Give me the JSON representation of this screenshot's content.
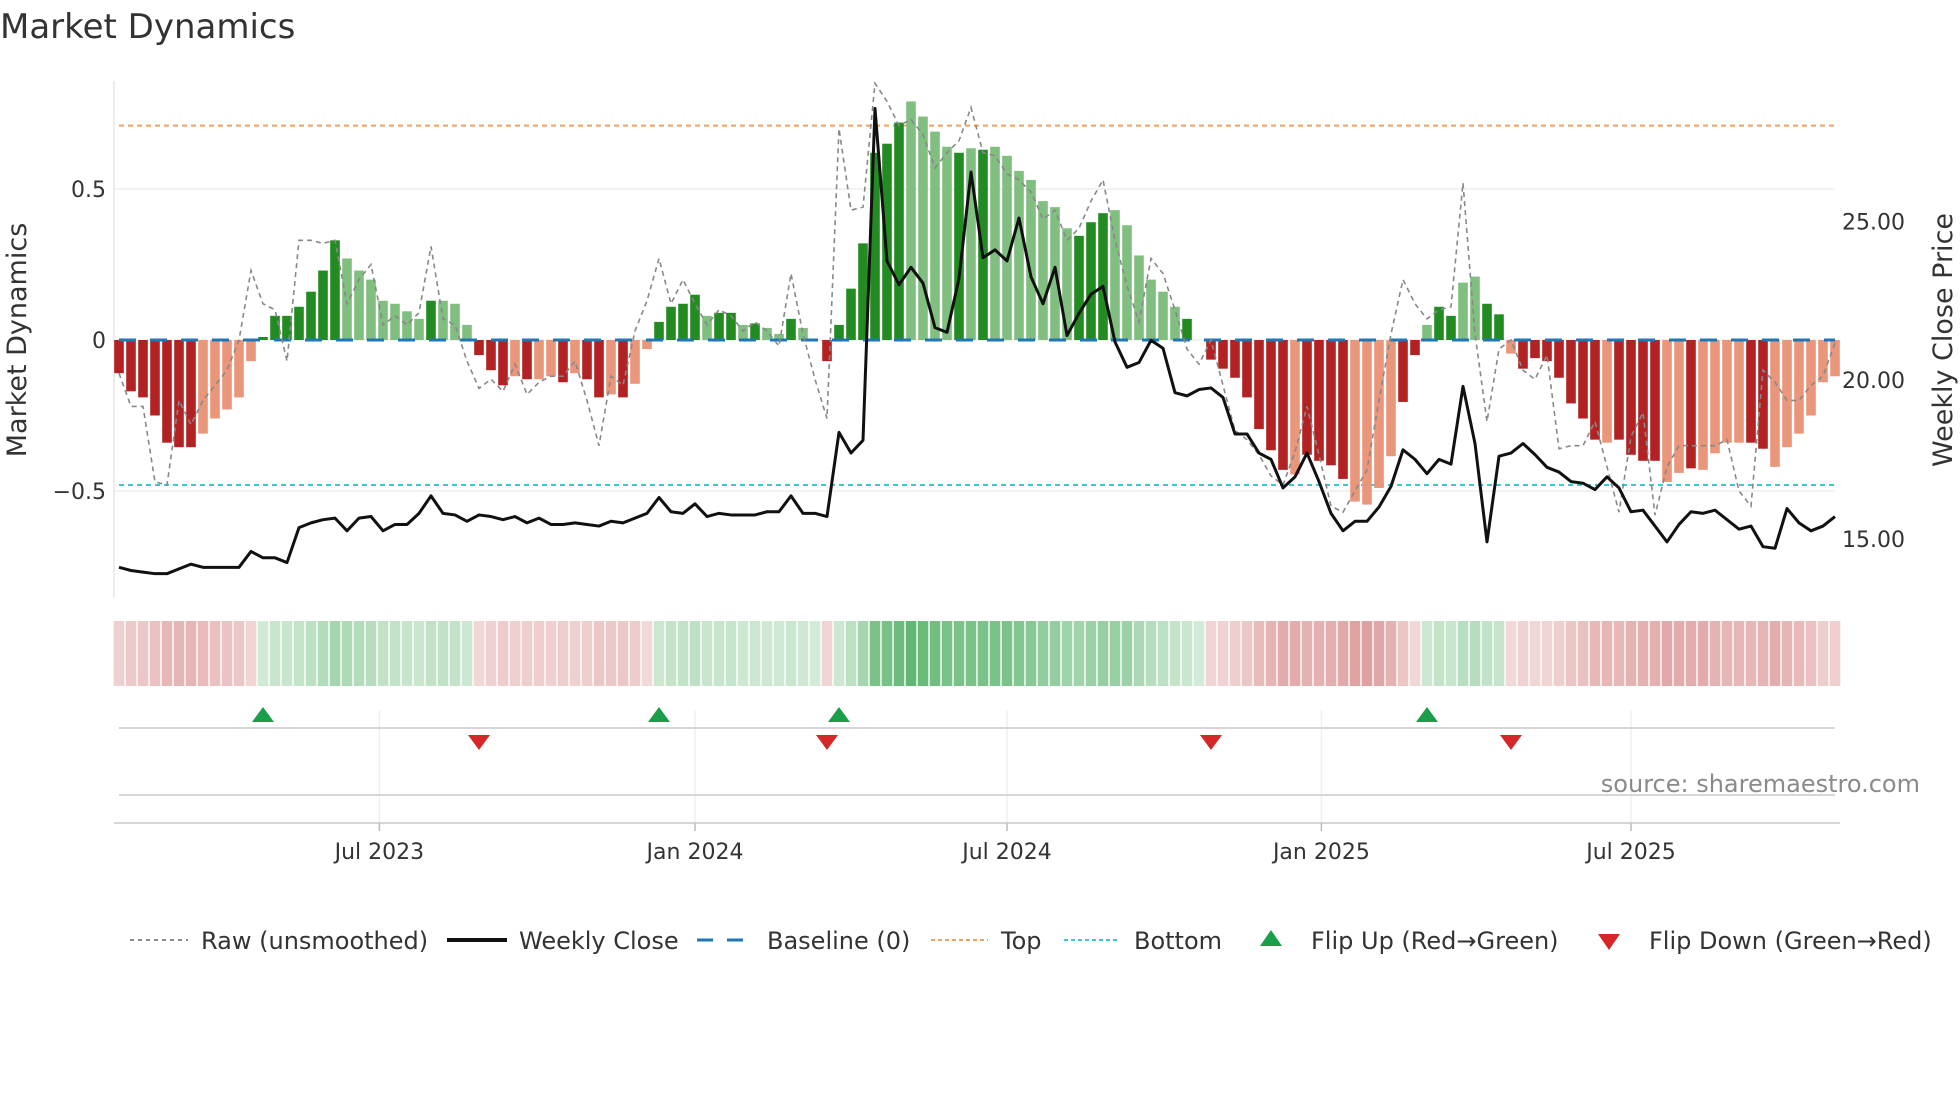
{
  "chart_data": {
    "type": "bar",
    "title": "Market Dynamics",
    "ylabel": "Market Dynamics",
    "y2label": "Weekly Close Price",
    "ylim": [
      -0.88,
      0.88
    ],
    "y_ticks": [
      {
        "v": 0.5,
        "label": "0.5"
      },
      {
        "v": 0,
        "label": "0"
      },
      {
        "v": -0.5,
        "label": "−0.5"
      }
    ],
    "y2_ticks": [
      {
        "v": 25,
        "label": "25.00"
      },
      {
        "v": 20,
        "label": "20.00"
      },
      {
        "v": 15,
        "label": "15.00"
      }
    ],
    "x_ticks": [
      {
        "week": 21.7,
        "label": "Jul 2023"
      },
      {
        "week": 48,
        "label": "Jan 2024"
      },
      {
        "week": 74,
        "label": "Jul 2024"
      },
      {
        "week": 100.2,
        "label": "Jan 2025"
      },
      {
        "week": 126,
        "label": "Jul 2025"
      }
    ],
    "top_level": 0.71,
    "bottom_level": -0.48,
    "baseline": 0,
    "bars": [
      -0.11,
      -0.17,
      -0.19,
      -0.25,
      -0.34,
      -0.355,
      -0.355,
      -0.31,
      -0.26,
      -0.23,
      -0.19,
      -0.07,
      0.01,
      0.08,
      0.08,
      0.11,
      0.16,
      0.23,
      0.33,
      0.27,
      0.23,
      0.2,
      0.13,
      0.12,
      0.095,
      0.07,
      0.13,
      0.13,
      0.12,
      0.05,
      -0.05,
      -0.1,
      -0.15,
      -0.12,
      -0.13,
      -0.13,
      -0.12,
      -0.14,
      -0.11,
      -0.13,
      -0.19,
      -0.18,
      -0.19,
      -0.145,
      -0.03,
      0.06,
      0.11,
      0.12,
      0.15,
      0.08,
      0.09,
      0.09,
      0.05,
      0.055,
      0.04,
      0.02,
      0.07,
      0.04,
      0,
      -0.07,
      0.05,
      0.17,
      0.32,
      0.62,
      0.65,
      0.72,
      0.79,
      0.74,
      0.69,
      0.64,
      0.62,
      0.635,
      0.63,
      0.64,
      0.61,
      0.56,
      0.53,
      0.46,
      0.44,
      0.37,
      0.345,
      0.39,
      0.42,
      0.43,
      0.38,
      0.28,
      0.2,
      0.16,
      0.11,
      0.07,
      0,
      -0.065,
      -0.095,
      -0.125,
      -0.19,
      -0.295,
      -0.365,
      -0.43,
      -0.445,
      -0.38,
      -0.4,
      -0.415,
      -0.46,
      -0.535,
      -0.545,
      -0.49,
      -0.385,
      -0.205,
      -0.05,
      0.05,
      0.11,
      0.08,
      0.19,
      0.21,
      0.12,
      0.085,
      -0.045,
      -0.095,
      -0.06,
      -0.07,
      -0.125,
      -0.21,
      -0.26,
      -0.33,
      -0.34,
      -0.33,
      -0.38,
      -0.4,
      -0.4,
      -0.47,
      -0.44,
      -0.425,
      -0.43,
      -0.375,
      -0.34,
      -0.34,
      -0.34,
      -0.36,
      -0.42,
      -0.355,
      -0.31,
      -0.25,
      -0.14,
      -0.12
    ],
    "bar_strength": "DDDDDDDLLLLLDDDDDDDLLLLLLLDLLLDDDLDLLDLDDLDLLDDDDLDDLDLLDLDDDDDDDDLLLLDLDLLLLLLLDDDLLLLLLDDDDDDDDDLDDDDLLLLDDLDDLLDDLDDDDDDDLDDDDLLDLLLLDDLLLLL",
    "raw": [
      -0.11,
      -0.22,
      -0.22,
      -0.47,
      -0.48,
      -0.2,
      -0.28,
      -0.2,
      -0.15,
      -0.1,
      0.0,
      0.23,
      0.12,
      0.1,
      -0.07,
      0.33,
      0.33,
      0.32,
      0.33,
      0.12,
      0.2,
      0.25,
      0.05,
      0.08,
      0.05,
      0.09,
      0.31,
      0.07,
      0.05,
      -0.07,
      -0.16,
      -0.13,
      -0.17,
      -0.08,
      -0.18,
      -0.14,
      -0.12,
      -0.12,
      -0.07,
      -0.2,
      -0.35,
      -0.12,
      -0.15,
      0.03,
      0.13,
      0.27,
      0.12,
      0.2,
      0.12,
      0.05,
      0.1,
      0.08,
      0.03,
      0.06,
      0.03,
      -0.02,
      0.22,
      0.02,
      -0.13,
      -0.26,
      0.7,
      0.43,
      0.44,
      0.85,
      0.79,
      0.71,
      0.73,
      0.68,
      0.57,
      0.62,
      0.66,
      0.77,
      0.62,
      0.61,
      0.55,
      0.53,
      0.49,
      0.4,
      0.43,
      0.33,
      0.37,
      0.46,
      0.53,
      0.33,
      0.18,
      0.06,
      0.27,
      0.22,
      0.1,
      -0.03,
      -0.08,
      0.0,
      -0.15,
      -0.3,
      -0.33,
      -0.38,
      -0.45,
      -0.48,
      -0.37,
      -0.22,
      -0.38,
      -0.55,
      -0.57,
      -0.5,
      -0.43,
      -0.2,
      0.02,
      0.2,
      0.12,
      0.07,
      0.1,
      0.11,
      0.52,
      0.02,
      -0.27,
      -0.03,
      0.0,
      -0.1,
      -0.13,
      -0.05,
      -0.36,
      -0.35,
      -0.35,
      -0.27,
      -0.42,
      -0.57,
      -0.32,
      -0.24,
      -0.58,
      -0.42,
      -0.35,
      -0.35,
      -0.35,
      -0.35,
      -0.33,
      -0.5,
      -0.55,
      -0.1,
      -0.14,
      -0.2,
      -0.2,
      -0.15,
      -0.12,
      -0.01
    ],
    "close": [
      14.1,
      14.0,
      13.95,
      13.9,
      13.9,
      14.05,
      14.2,
      14.1,
      14.1,
      14.1,
      14.1,
      14.6,
      14.4,
      14.4,
      14.25,
      15.35,
      15.5,
      15.6,
      15.65,
      15.25,
      15.65,
      15.7,
      15.25,
      15.45,
      15.45,
      15.8,
      16.35,
      15.8,
      15.75,
      15.55,
      15.75,
      15.7,
      15.6,
      15.7,
      15.5,
      15.65,
      15.45,
      15.45,
      15.5,
      15.45,
      15.4,
      15.55,
      15.5,
      15.65,
      15.8,
      16.3,
      15.85,
      15.8,
      16.1,
      15.7,
      15.8,
      15.75,
      15.75,
      15.75,
      15.85,
      15.85,
      16.35,
      15.8,
      15.8,
      15.7,
      18.35,
      17.7,
      18.1,
      28.55,
      23.75,
      23.0,
      23.55,
      23.05,
      21.65,
      21.5,
      23.2,
      26.55,
      23.85,
      24.1,
      23.75,
      25.1,
      23.25,
      22.4,
      23.55,
      21.4,
      22.1,
      22.7,
      22.95,
      21.2,
      20.4,
      20.55,
      21.25,
      21.0,
      19.6,
      19.5,
      19.7,
      19.75,
      19.45,
      18.3,
      18.3,
      17.7,
      17.5,
      16.6,
      16.95,
      17.7,
      16.8,
      15.8,
      15.25,
      15.55,
      15.55,
      16.0,
      16.65,
      17.8,
      17.5,
      17.05,
      17.5,
      17.35,
      19.8,
      18.0,
      14.9,
      17.6,
      17.7,
      18.0,
      17.65,
      17.25,
      17.1,
      16.8,
      16.75,
      16.55,
      16.95,
      16.6,
      15.85,
      15.9,
      15.4,
      14.9,
      15.45,
      15.85,
      15.8,
      15.9,
      15.6,
      15.3,
      15.4,
      14.75,
      14.7,
      15.95,
      15.5,
      15.25,
      15.4,
      15.7
    ],
    "flip_up_weeks": [
      12,
      45,
      60,
      109
    ],
    "flip_down_weeks": [
      30,
      59,
      91,
      116
    ],
    "legend": {
      "position": "bottom",
      "raw": "Raw (unsmoothed)",
      "close": "Weekly Close",
      "baseline": "Baseline (0)",
      "top": "Top",
      "bottom": "Bottom",
      "flip_up": "Flip Up (Red→Green)",
      "flip_down": "Flip Down (Green→Red)"
    }
  },
  "source": "source: sharemaestro.com",
  "colors": {
    "green_strong": "#228b22",
    "green_weak": "#80bf80",
    "red_strong": "#b22222",
    "red_weak": "#e9967a",
    "top": "#f0a060",
    "bottom": "#3cc8d8",
    "baseline": "#1f77b4",
    "flip_up": "#1a9e4a",
    "flip_down": "#d62728"
  }
}
